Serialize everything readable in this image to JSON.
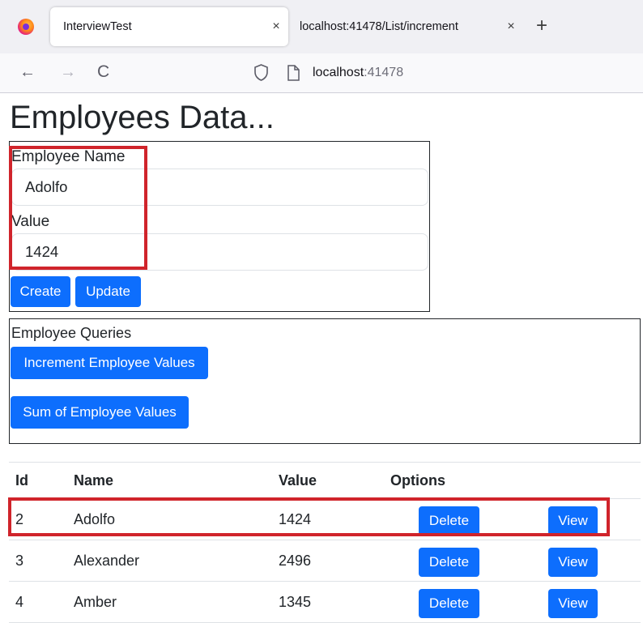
{
  "browser": {
    "tabs": [
      {
        "title": "InterviewTest",
        "active": true
      },
      {
        "title": "localhost:41478/List/increment",
        "active": false
      }
    ],
    "url": {
      "host": "localhost",
      "port": ":41478"
    },
    "icons": {
      "logo": "firefox-logo-icon",
      "close": "×",
      "new_tab": "+",
      "back": "←",
      "forward": "→",
      "reload": "C"
    }
  },
  "page": {
    "title": "Employees Data..."
  },
  "form": {
    "name_label": "Employee Name",
    "name_value": "Adolfo",
    "value_label": "Value",
    "value_value": "1424",
    "create_label": "Create",
    "update_label": "Update"
  },
  "queries": {
    "label": "Employee Queries",
    "increment_label": "Increment Employee Values",
    "sum_label": "Sum of Employee Values"
  },
  "table": {
    "headers": [
      "Id",
      "Name",
      "Value",
      "Options"
    ],
    "rows": [
      {
        "id": "2",
        "name": "Adolfo",
        "value": "1424",
        "delete": "Delete",
        "view": "View"
      },
      {
        "id": "3",
        "name": "Alexander",
        "value": "2496",
        "delete": "Delete",
        "view": "View"
      },
      {
        "id": "4",
        "name": "Amber",
        "value": "1345",
        "delete": "Delete",
        "view": "View"
      }
    ]
  },
  "colors": {
    "primary": "#0d6efd",
    "highlight": "#d0242b",
    "tabbar": "#f0f0f4"
  }
}
